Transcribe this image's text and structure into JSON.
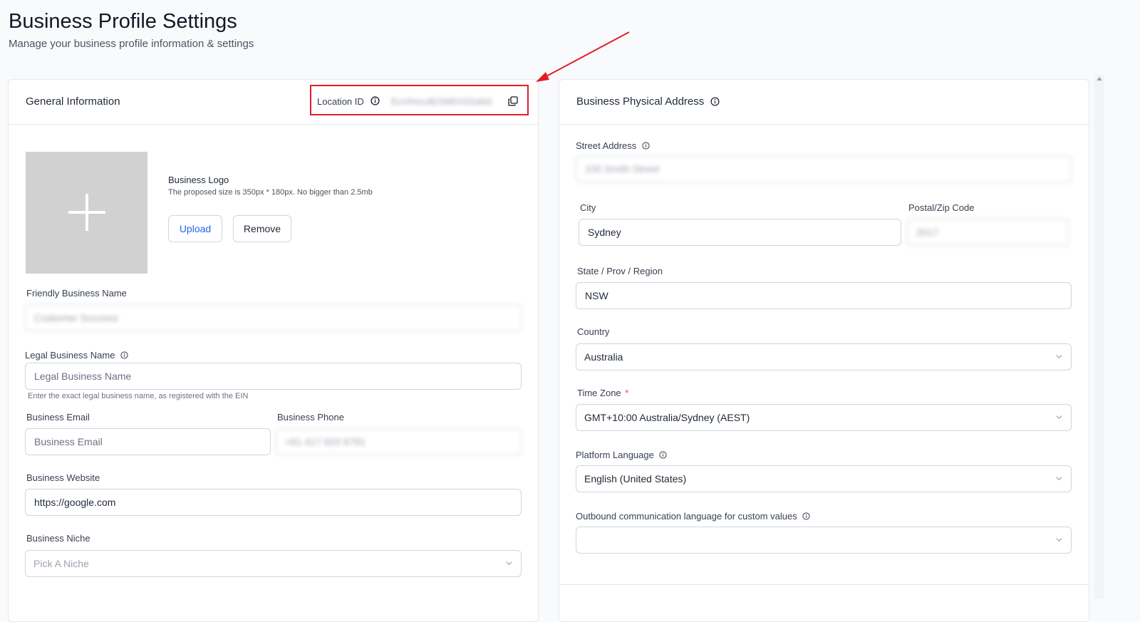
{
  "page": {
    "title": "Business Profile Settings",
    "subtitle": "Manage your business profile information & settings"
  },
  "general": {
    "header": "General Information",
    "location_id_label": "Location ID",
    "location_id_value": "EuVhmcdESMKH32a6i4",
    "logo": {
      "label": "Business Logo",
      "hint": "The proposed size is 350px * 180px. No bigger than 2.5mb",
      "upload": "Upload",
      "remove": "Remove"
    },
    "friendly_name": {
      "label": "Friendly Business Name",
      "value": "Customer Success"
    },
    "legal_name": {
      "label": "Legal Business Name",
      "placeholder": "Legal Business Name",
      "hint": "Enter the exact legal business name, as registered with the EIN"
    },
    "email": {
      "label": "Business Email",
      "placeholder": "Business Email"
    },
    "phone": {
      "label": "Business Phone",
      "value": "+61 417 820 6781"
    },
    "website": {
      "label": "Business Website",
      "value": "https://google.com"
    },
    "niche": {
      "label": "Business Niche",
      "placeholder": "Pick A Niche"
    }
  },
  "address": {
    "header": "Business Physical Address",
    "street": {
      "label": "Street Address",
      "value": "100 Smith Street"
    },
    "city": {
      "label": "City",
      "value": "Sydney"
    },
    "postal": {
      "label": "Postal/Zip Code",
      "value": "2017"
    },
    "state": {
      "label": "State / Prov / Region",
      "value": "NSW"
    },
    "country": {
      "label": "Country",
      "value": "Australia"
    },
    "timezone": {
      "label": "Time Zone",
      "required_mark": "*",
      "value": "GMT+10:00 Australia/Sydney (AEST)"
    },
    "platform_language": {
      "label": "Platform Language",
      "value": "English (United States)"
    },
    "outbound_language": {
      "label": "Outbound communication language for custom values",
      "value": ""
    }
  },
  "colors": {
    "annotation_red": "#e11d2a",
    "primary_blue": "#2563eb",
    "required_red": "#ef4444"
  }
}
